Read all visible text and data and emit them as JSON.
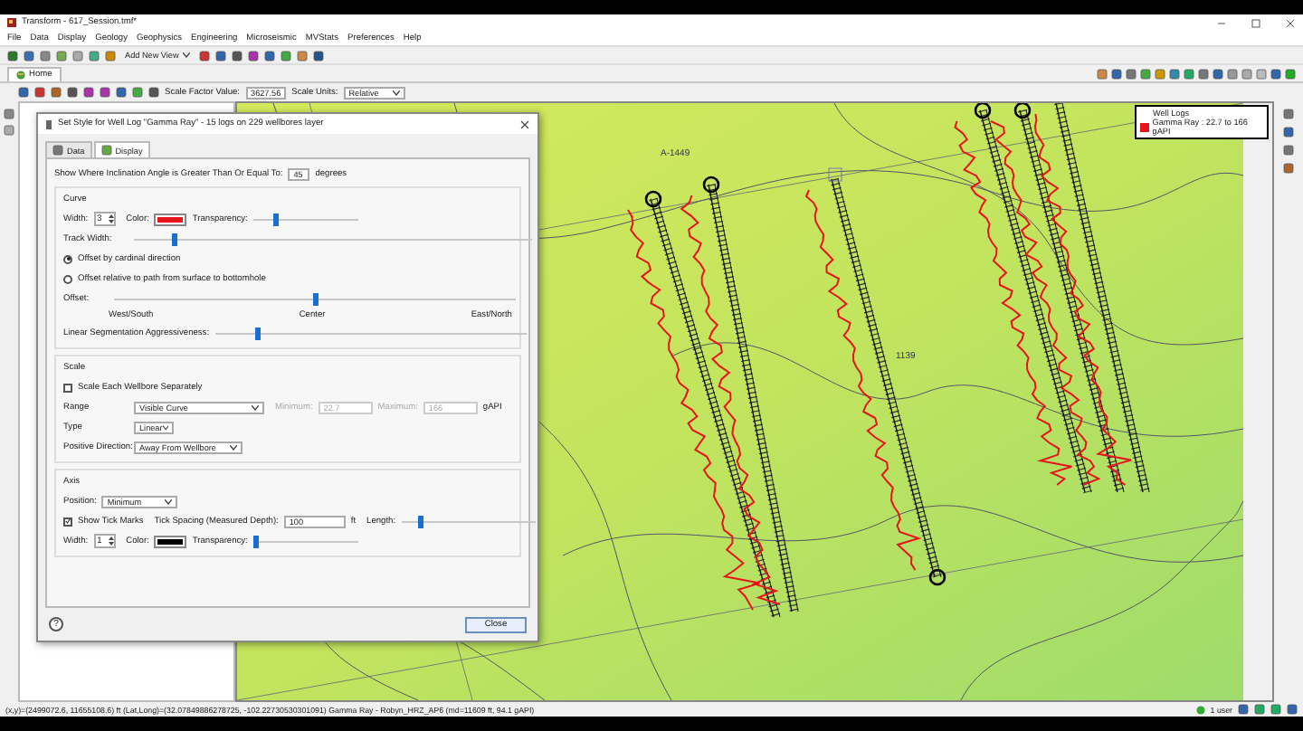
{
  "window": {
    "title": "Transform - 617_Session.tmf*"
  },
  "menu": [
    "File",
    "Data",
    "Display",
    "Geology",
    "Geophysics",
    "Engineering",
    "Microseismic",
    "MVStats",
    "Preferences",
    "Help"
  ],
  "toolbar": {
    "view_menu": "Add New View"
  },
  "tabs": [
    {
      "label": "Home",
      "selected": true
    }
  ],
  "map_toolbar": {
    "scale_factor_label": "Scale Factor Value:",
    "scale_factor": "3627.56",
    "scale_units_label": "Scale Units:",
    "scale_units": "Relative"
  },
  "map": {
    "labels": [
      "A-1449",
      "1139"
    ],
    "legend": {
      "title": "Well Logs",
      "items": [
        {
          "label": "Gamma Ray : 22.7 to 166 gAPI",
          "color": "#e8141c"
        }
      ]
    }
  },
  "dialog": {
    "title": "Set Style for Well Log \"Gamma Ray\" - 15 logs on 229 wellbores layer",
    "tabs": [
      {
        "label": "Data",
        "selected": false
      },
      {
        "label": "Display",
        "selected": true
      }
    ],
    "inclination": {
      "label": "Show Where Inclination Angle is Greater Than Or Equal To:",
      "value": "45",
      "unit": "degrees"
    },
    "curve": {
      "title": "Curve",
      "width": {
        "label": "Width:",
        "value": "3"
      },
      "color": {
        "label": "Color:",
        "color": "#e8141c"
      },
      "transparency": {
        "label": "Transparency:",
        "level": 0.22
      },
      "track_width": {
        "label": "Track Width:",
        "level": 0.1
      },
      "offset_modes": [
        {
          "label": "Offset by cardinal direction",
          "selected": true
        },
        {
          "label": "Offset relative to path from surface to bottomhole",
          "selected": false
        }
      ],
      "offset": {
        "label": "Offset:",
        "level": 0.5
      },
      "offset_marks": [
        "West/South",
        "Center",
        "East/North"
      ],
      "segmentation": {
        "label": "Linear Segmentation Aggressiveness:",
        "level": 0.14
      }
    },
    "scale": {
      "title": "Scale",
      "separate": {
        "label": "Scale Each Wellbore Separately",
        "checked": false
      },
      "range": {
        "label": "Range",
        "value": "Visible Curve"
      },
      "minimum": {
        "label": "Minimum:",
        "value": "22.7",
        "disabled": true
      },
      "maximum": {
        "label": "Maximum:",
        "value": "166",
        "disabled": true
      },
      "unit": "gAPI",
      "type": {
        "label": "Type",
        "value": "Linear"
      },
      "direction": {
        "label": "Positive Direction:",
        "value": "Away From Wellbore"
      }
    },
    "axis": {
      "title": "Axis",
      "position": {
        "label": "Position:",
        "value": "Minimum"
      },
      "ticks": {
        "label": "Show Tick Marks",
        "checked": true
      },
      "spacing": {
        "label": "Tick Spacing (Measured Depth):",
        "value": "100",
        "unit": "ft"
      },
      "length": {
        "label": "Length:",
        "level": 0.15
      },
      "width": {
        "label": "Width:",
        "value": "1"
      },
      "color": {
        "label": "Color:",
        "color": "#000000"
      },
      "transparency": {
        "label": "Transparency:",
        "level": 0.02
      }
    },
    "help": "?",
    "close": "Close"
  },
  "status_bar": {
    "text": "(x,y)=(2499072.6, 11655108.6) ft (Lat,Long)=(32.07849886278725, -102.22730530301091)  Gamma Ray - Robyn_HRZ_AP6 (md=11609 ft, 94.1 gAPI)",
    "users": "1 user"
  }
}
